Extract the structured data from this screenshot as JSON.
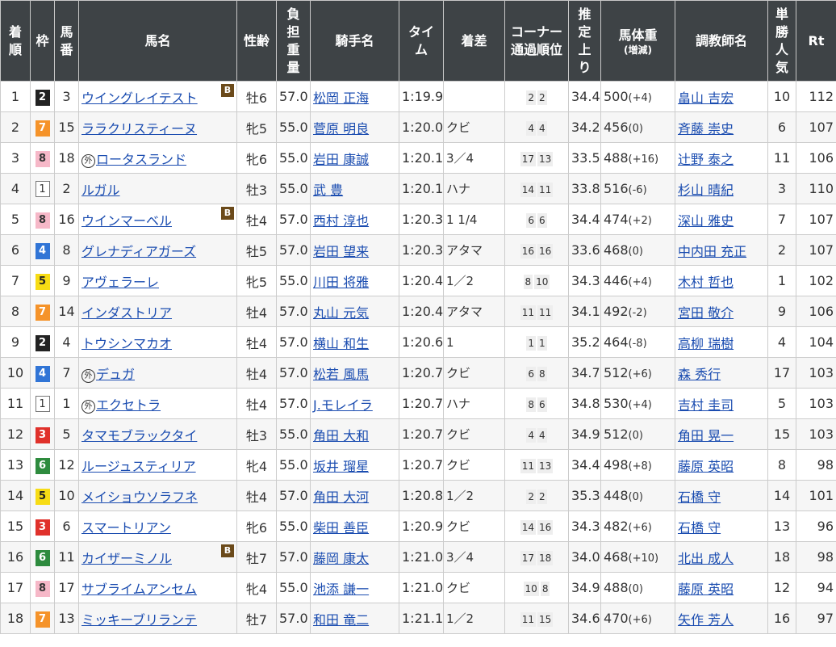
{
  "headers": {
    "rank": "着順",
    "waku": "枠",
    "num": "馬番",
    "horse": "馬名",
    "sexage": "性齢",
    "weight": "負担重量",
    "jockey": "騎手名",
    "time": "タイム",
    "margin": "着差",
    "corner_1": "コーナー",
    "corner_2": "通過順位",
    "agari": "推定上り",
    "body_1": "馬体重",
    "body_2": "(増減)",
    "trainer": "調教師名",
    "pop": "単勝人気",
    "rt": "Rt"
  },
  "rows": [
    {
      "rank": "1",
      "waku": "2",
      "num": "3",
      "gai": "",
      "horse": "ウイングレイテスト",
      "blinker": "B",
      "sexage": "牡6",
      "weight": "57.0",
      "jockey": "松岡 正海",
      "time": "1:19.9",
      "margin": "",
      "c1": "2",
      "c2": "2",
      "agari": "34.4",
      "body": "500",
      "diff": "(+4)",
      "trainer": "畠山 吉宏",
      "pop": "10",
      "rt": "112"
    },
    {
      "rank": "2",
      "waku": "7",
      "num": "15",
      "gai": "",
      "horse": "ララクリスティーヌ",
      "blinker": "",
      "sexage": "牝5",
      "weight": "55.0",
      "jockey": "菅原 明良",
      "time": "1:20.0",
      "margin": "クビ",
      "c1": "4",
      "c2": "4",
      "agari": "34.2",
      "body": "456",
      "diff": "(0)",
      "trainer": "斉藤 崇史",
      "pop": "6",
      "rt": "107"
    },
    {
      "rank": "3",
      "waku": "8",
      "num": "18",
      "gai": "外",
      "horse": "ロータスランド",
      "blinker": "",
      "sexage": "牝6",
      "weight": "55.0",
      "jockey": "岩田 康誠",
      "time": "1:20.1",
      "margin": "3／4",
      "c1": "17",
      "c2": "13",
      "agari": "33.5",
      "body": "488",
      "diff": "(+16)",
      "trainer": "辻野 泰之",
      "pop": "11",
      "rt": "106"
    },
    {
      "rank": "4",
      "waku": "1",
      "num": "2",
      "gai": "",
      "horse": "ルガル",
      "blinker": "",
      "sexage": "牡3",
      "weight": "55.0",
      "jockey": "武 豊",
      "time": "1:20.1",
      "margin": "ハナ",
      "c1": "14",
      "c2": "11",
      "agari": "33.8",
      "body": "516",
      "diff": "(-6)",
      "trainer": "杉山 晴紀",
      "pop": "3",
      "rt": "110"
    },
    {
      "rank": "5",
      "waku": "8",
      "num": "16",
      "gai": "",
      "horse": "ウインマーベル",
      "blinker": "B",
      "sexage": "牡4",
      "weight": "57.0",
      "jockey": "西村 淳也",
      "time": "1:20.3",
      "margin": "1 1/4",
      "c1": "6",
      "c2": "6",
      "agari": "34.4",
      "body": "474",
      "diff": "(+2)",
      "trainer": "深山 雅史",
      "pop": "7",
      "rt": "107"
    },
    {
      "rank": "6",
      "waku": "4",
      "num": "8",
      "gai": "",
      "horse": "グレナディアガーズ",
      "blinker": "",
      "sexage": "牡5",
      "weight": "57.0",
      "jockey": "岩田 望来",
      "time": "1:20.3",
      "margin": "アタマ",
      "c1": "16",
      "c2": "16",
      "agari": "33.6",
      "body": "468",
      "diff": "(0)",
      "trainer": "中内田 充正",
      "pop": "2",
      "rt": "107"
    },
    {
      "rank": "7",
      "waku": "5",
      "num": "9",
      "gai": "",
      "horse": "アヴェラーレ",
      "blinker": "",
      "sexage": "牝5",
      "weight": "55.0",
      "jockey": "川田 将雅",
      "time": "1:20.4",
      "margin": "1／2",
      "c1": "8",
      "c2": "10",
      "agari": "34.3",
      "body": "446",
      "diff": "(+4)",
      "trainer": "木村 哲也",
      "pop": "1",
      "rt": "102"
    },
    {
      "rank": "8",
      "waku": "7",
      "num": "14",
      "gai": "",
      "horse": "インダストリア",
      "blinker": "",
      "sexage": "牡4",
      "weight": "57.0",
      "jockey": "丸山 元気",
      "time": "1:20.4",
      "margin": "アタマ",
      "c1": "11",
      "c2": "11",
      "agari": "34.1",
      "body": "492",
      "diff": "(-2)",
      "trainer": "宮田 敬介",
      "pop": "9",
      "rt": "106"
    },
    {
      "rank": "9",
      "waku": "2",
      "num": "4",
      "gai": "",
      "horse": "トウシンマカオ",
      "blinker": "",
      "sexage": "牡4",
      "weight": "57.0",
      "jockey": "横山 和生",
      "time": "1:20.6",
      "margin": "1",
      "c1": "1",
      "c2": "1",
      "agari": "35.2",
      "body": "464",
      "diff": "(-8)",
      "trainer": "高柳 瑞樹",
      "pop": "4",
      "rt": "104"
    },
    {
      "rank": "10",
      "waku": "4",
      "num": "7",
      "gai": "外",
      "horse": "デュガ",
      "blinker": "",
      "sexage": "牡4",
      "weight": "57.0",
      "jockey": "松若 風馬",
      "time": "1:20.7",
      "margin": "クビ",
      "c1": "6",
      "c2": "8",
      "agari": "34.7",
      "body": "512",
      "diff": "(+6)",
      "trainer": "森 秀行",
      "pop": "17",
      "rt": "103"
    },
    {
      "rank": "11",
      "waku": "1",
      "num": "1",
      "gai": "外",
      "horse": "エクセトラ",
      "blinker": "",
      "sexage": "牡4",
      "weight": "57.0",
      "jockey": "J.モレイラ",
      "time": "1:20.7",
      "margin": "ハナ",
      "c1": "8",
      "c2": "6",
      "agari": "34.8",
      "body": "530",
      "diff": "(+4)",
      "trainer": "吉村 圭司",
      "pop": "5",
      "rt": "103"
    },
    {
      "rank": "12",
      "waku": "3",
      "num": "5",
      "gai": "",
      "horse": "タマモブラックタイ",
      "blinker": "",
      "sexage": "牡3",
      "weight": "55.0",
      "jockey": "角田 大和",
      "time": "1:20.7",
      "margin": "クビ",
      "c1": "4",
      "c2": "4",
      "agari": "34.9",
      "body": "512",
      "diff": "(0)",
      "trainer": "角田 晃一",
      "pop": "15",
      "rt": "103"
    },
    {
      "rank": "13",
      "waku": "6",
      "num": "12",
      "gai": "",
      "horse": "ルージュスティリア",
      "blinker": "",
      "sexage": "牝4",
      "weight": "55.0",
      "jockey": "坂井 瑠星",
      "time": "1:20.7",
      "margin": "クビ",
      "c1": "11",
      "c2": "13",
      "agari": "34.4",
      "body": "498",
      "diff": "(+8)",
      "trainer": "藤原 英昭",
      "pop": "8",
      "rt": "98"
    },
    {
      "rank": "14",
      "waku": "5",
      "num": "10",
      "gai": "",
      "horse": "メイショウソラフネ",
      "blinker": "",
      "sexage": "牡4",
      "weight": "57.0",
      "jockey": "角田 大河",
      "time": "1:20.8",
      "margin": "1／2",
      "c1": "2",
      "c2": "2",
      "agari": "35.3",
      "body": "448",
      "diff": "(0)",
      "trainer": "石橋 守",
      "pop": "14",
      "rt": "101"
    },
    {
      "rank": "15",
      "waku": "3",
      "num": "6",
      "gai": "",
      "horse": "スマートリアン",
      "blinker": "",
      "sexage": "牝6",
      "weight": "55.0",
      "jockey": "柴田 善臣",
      "time": "1:20.9",
      "margin": "クビ",
      "c1": "14",
      "c2": "16",
      "agari": "34.3",
      "body": "482",
      "diff": "(+6)",
      "trainer": "石橋 守",
      "pop": "13",
      "rt": "96"
    },
    {
      "rank": "16",
      "waku": "6",
      "num": "11",
      "gai": "",
      "horse": "カイザーミノル",
      "blinker": "B",
      "sexage": "牡7",
      "weight": "57.0",
      "jockey": "藤岡 康太",
      "time": "1:21.0",
      "margin": "3／4",
      "c1": "17",
      "c2": "18",
      "agari": "34.0",
      "body": "468",
      "diff": "(+10)",
      "trainer": "北出 成人",
      "pop": "18",
      "rt": "98"
    },
    {
      "rank": "17",
      "waku": "8",
      "num": "17",
      "gai": "",
      "horse": "サブライムアンセム",
      "blinker": "",
      "sexage": "牝4",
      "weight": "55.0",
      "jockey": "池添 謙一",
      "time": "1:21.0",
      "margin": "クビ",
      "c1": "10",
      "c2": "8",
      "agari": "34.9",
      "body": "488",
      "diff": "(0)",
      "trainer": "藤原 英昭",
      "pop": "12",
      "rt": "94"
    },
    {
      "rank": "18",
      "waku": "7",
      "num": "13",
      "gai": "",
      "horse": "ミッキーブリランテ",
      "blinker": "",
      "sexage": "牡7",
      "weight": "57.0",
      "jockey": "和田 竜二",
      "time": "1:21.1",
      "margin": "1／2",
      "c1": "11",
      "c2": "15",
      "agari": "34.6",
      "body": "470",
      "diff": "(+6)",
      "trainer": "矢作 芳人",
      "pop": "16",
      "rt": "97"
    }
  ]
}
